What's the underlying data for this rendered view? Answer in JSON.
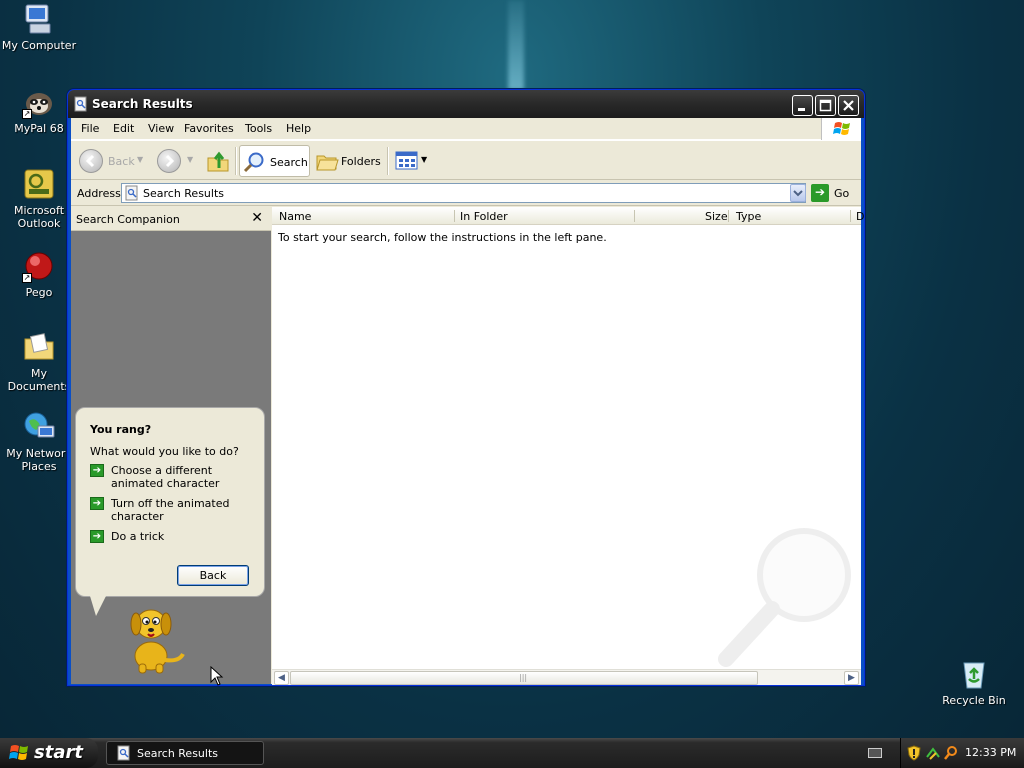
{
  "desktop": {
    "icons": [
      {
        "label": "My Computer"
      },
      {
        "label": "MyPal 68"
      },
      {
        "label": "Microsoft Outlook"
      },
      {
        "label": "Pego"
      },
      {
        "label": "My Documents"
      },
      {
        "label": "My Network Places"
      },
      {
        "label": "Recycle Bin"
      }
    ]
  },
  "window": {
    "title": "Search Results",
    "menu": [
      "File",
      "Edit",
      "View",
      "Favorites",
      "Tools",
      "Help"
    ],
    "toolbar": {
      "back_label": "Back",
      "search_label": "Search",
      "folders_label": "Folders"
    },
    "address": {
      "label": "Address",
      "value": "Search Results",
      "go_label": "Go"
    },
    "search_companion": {
      "title": "Search Companion",
      "bubble_heading": "You rang?",
      "bubble_prompt": "What would you like to do?",
      "options": [
        "Choose a different animated character",
        "Turn off the animated character",
        "Do a trick"
      ],
      "back_button": "Back"
    },
    "results": {
      "columns": [
        "Name",
        "In Folder",
        "Size",
        "Type",
        "D"
      ],
      "empty_message": "To start your search, follow the instructions in the left pane."
    }
  },
  "taskbar": {
    "start_label": "start",
    "task_item": "Search Results",
    "clock": "12:33 PM"
  },
  "colors": {
    "desktop_bg": "#0f4458",
    "titlebar": "#2a2a2a",
    "option_arrow": "#2a9a2a"
  }
}
